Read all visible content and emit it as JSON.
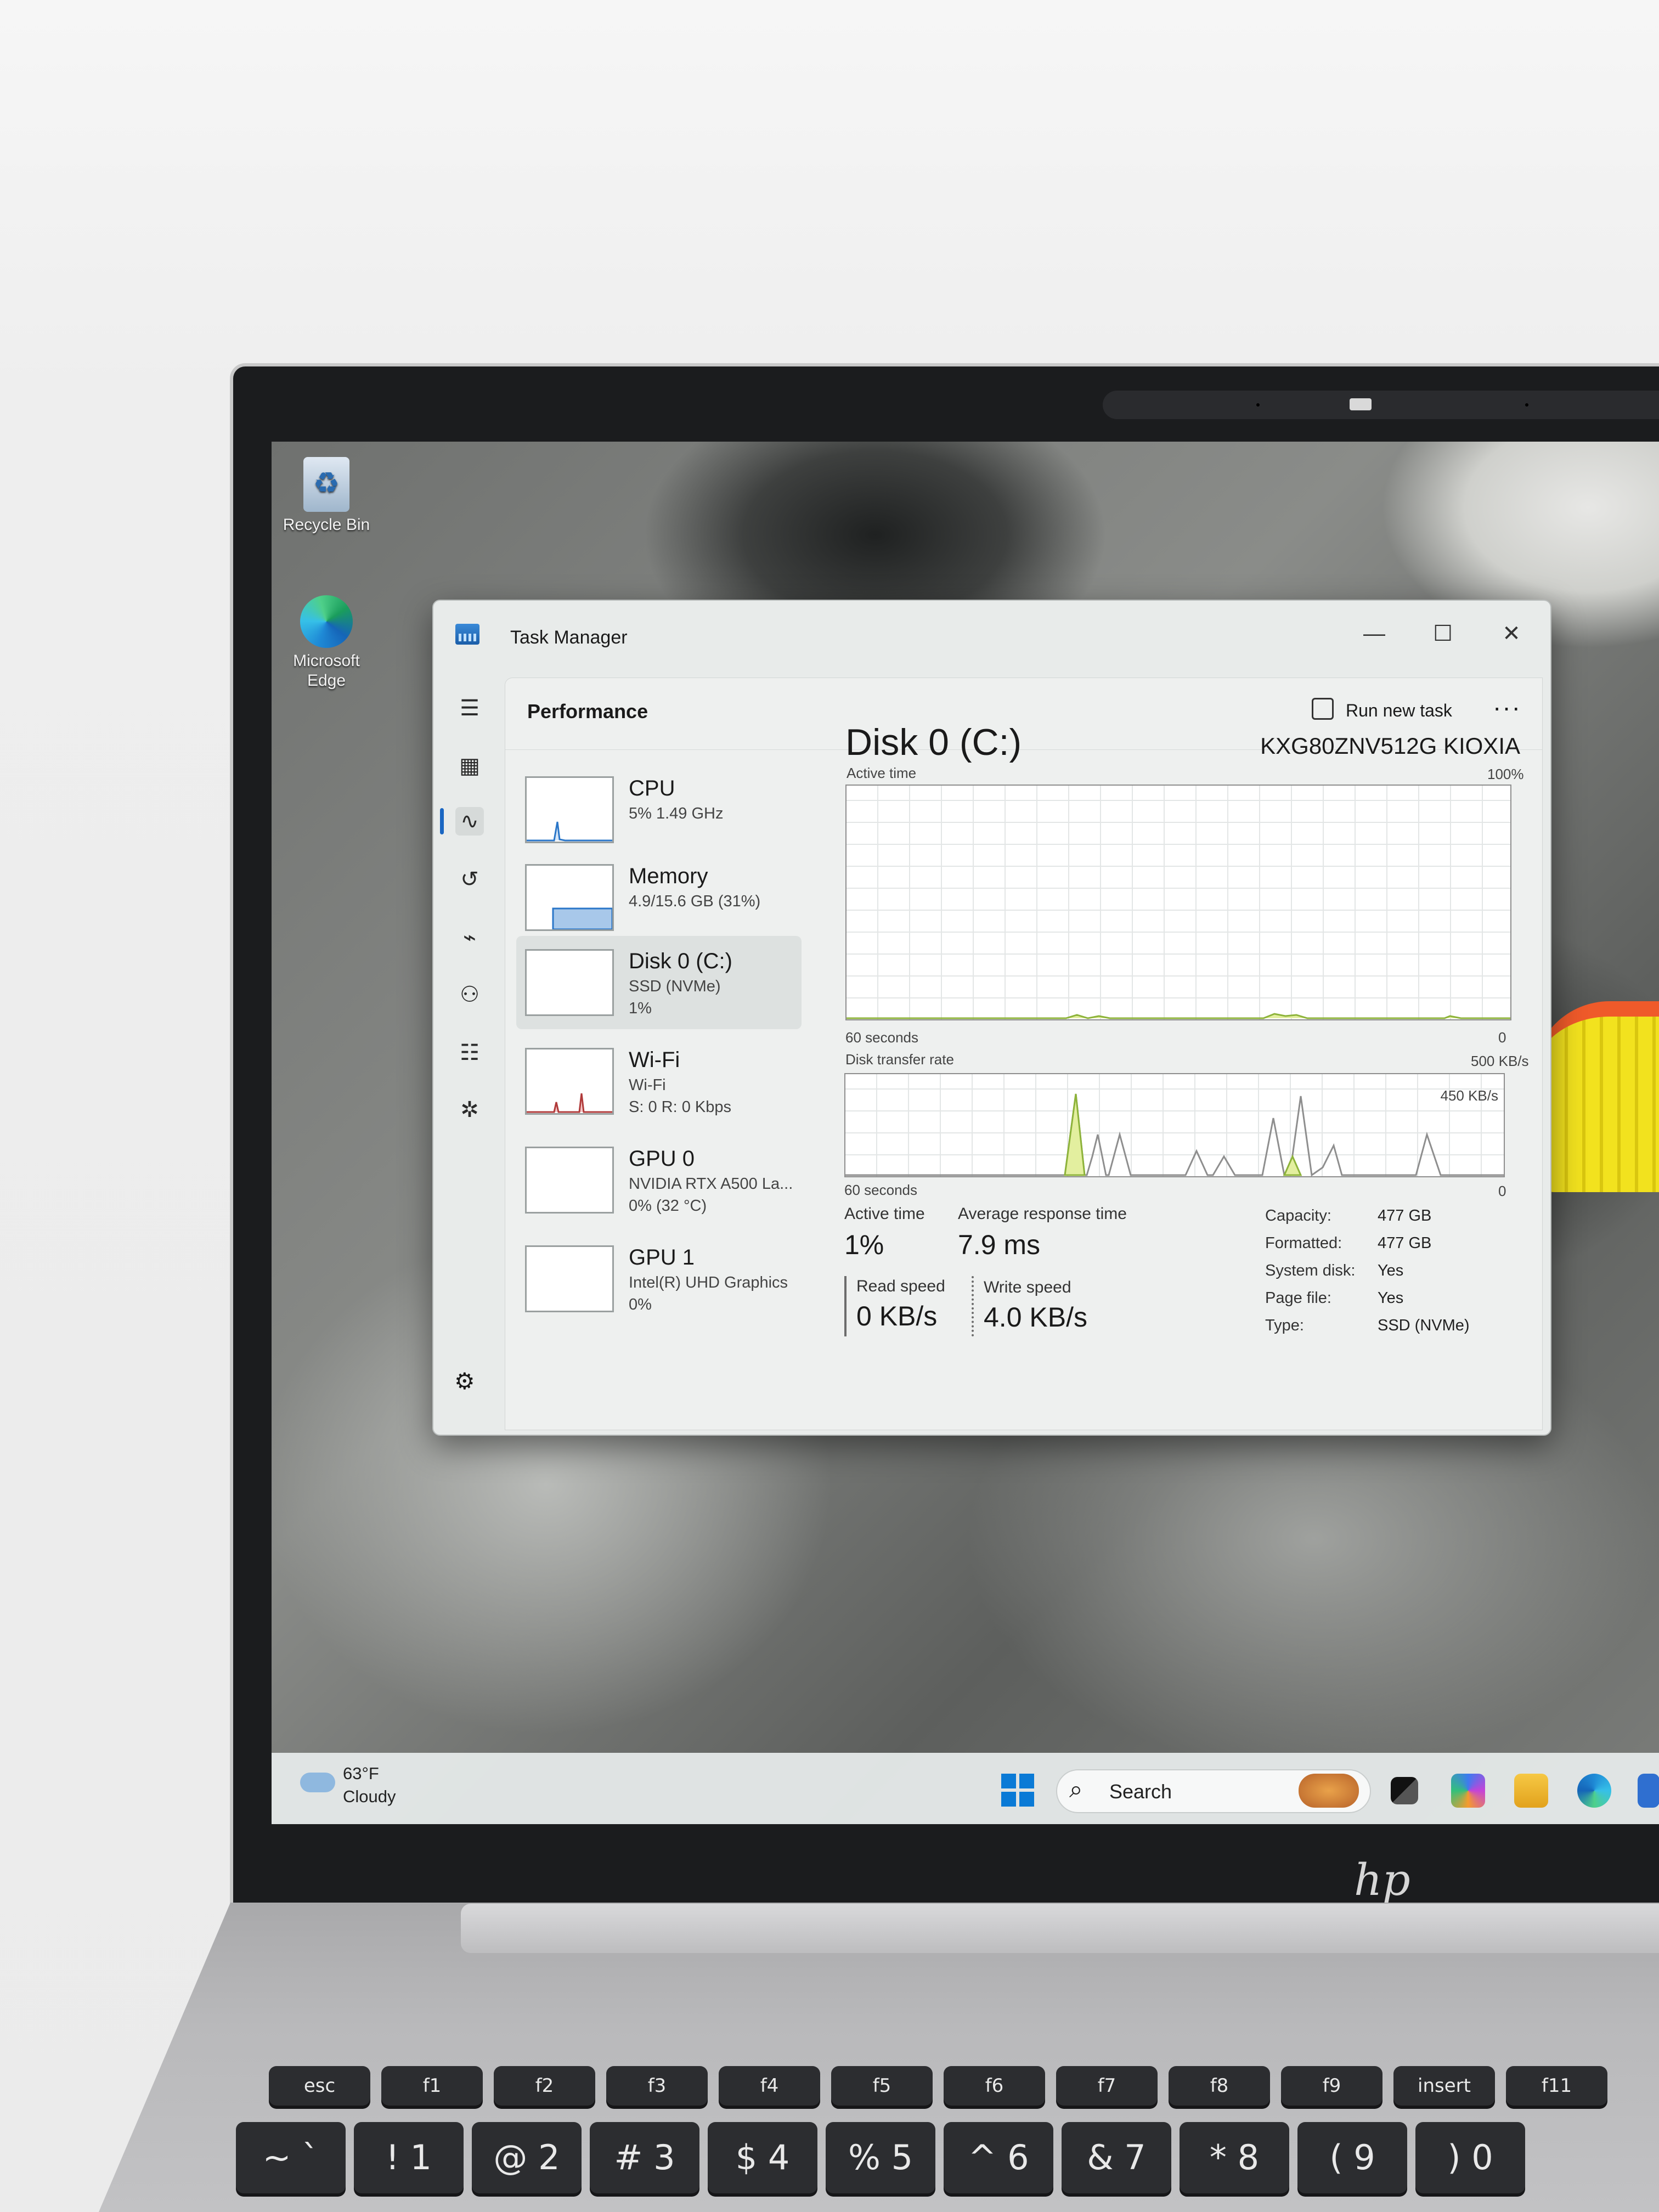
{
  "desktop": {
    "icons": [
      {
        "label": "Recycle Bin",
        "icon": "recycle-bin-icon"
      },
      {
        "label": "Microsoft Edge",
        "icon": "edge-icon"
      }
    ]
  },
  "window": {
    "title": "Task Manager",
    "controls": {
      "minimize": "—",
      "maximize": "☐",
      "close": "✕"
    }
  },
  "nav": {
    "items": [
      "menu-icon",
      "processes-icon",
      "performance-icon",
      "app-history-icon",
      "startup-apps-icon",
      "users-icon",
      "details-icon",
      "services-icon",
      "settings-icon"
    ],
    "active": "performance"
  },
  "header": {
    "title": "Performance",
    "run_new_task": "Run new task",
    "more": "···"
  },
  "devices": [
    {
      "name": "CPU",
      "sub1": "5%  1.49 GHz",
      "sub2": ""
    },
    {
      "name": "Memory",
      "sub1": "4.9/15.6 GB (31%)",
      "sub2": ""
    },
    {
      "name": "Disk 0 (C:)",
      "sub1": "SSD (NVMe)",
      "sub2": "1%"
    },
    {
      "name": "Wi-Fi",
      "sub1": "Wi-Fi",
      "sub2": "S: 0  R: 0 Kbps"
    },
    {
      "name": "GPU 0",
      "sub1": "NVIDIA RTX A500 La...",
      "sub2": "0%  (32 °C)"
    },
    {
      "name": "GPU 1",
      "sub1": "Intel(R) UHD Graphics",
      "sub2": "0%"
    }
  ],
  "detail": {
    "title": "Disk 0 (C:)",
    "model": "KXG80ZNV512G KIOXIA",
    "active_graph": {
      "label": "Active time",
      "max": "100%",
      "span": "60 seconds",
      "min": "0"
    },
    "transfer_graph": {
      "label": "Disk transfer rate",
      "max": "500 KB/s",
      "inner_max": "450 KB/s",
      "span": "60 seconds",
      "min": "0"
    },
    "stats": {
      "active_time_label": "Active time",
      "active_time_value": "1%",
      "response_label": "Average response time",
      "response_value": "7.9 ms",
      "read_label": "Read speed",
      "read_value": "0 KB/s",
      "write_label": "Write speed",
      "write_value": "4.0 KB/s"
    },
    "properties": [
      {
        "label": "Capacity:",
        "value": "477 GB"
      },
      {
        "label": "Formatted:",
        "value": "477 GB"
      },
      {
        "label": "System disk:",
        "value": "Yes"
      },
      {
        "label": "Page file:",
        "value": "Yes"
      },
      {
        "label": "Type:",
        "value": "SSD (NVMe)"
      }
    ]
  },
  "taskbar": {
    "weather_temp": "63°F",
    "weather_cond": "Cloudy",
    "search_placeholder": "Search",
    "apps": [
      "start-icon",
      "task-view-icon",
      "copilot-icon",
      "file-explorer-icon",
      "edge-icon",
      "store-icon"
    ]
  },
  "laptop": {
    "brand": "hp",
    "fn_keys": [
      "esc",
      "f1",
      "f2",
      "f3",
      "f4",
      "f5",
      "f6",
      "f7",
      "f8",
      "f9",
      "insert",
      "f11"
    ],
    "num_keys": [
      "~ `",
      "! 1",
      "@ 2",
      "# 3",
      "$ 4",
      "% 5",
      "^ 6",
      "& 7",
      "* 8",
      "( 9",
      ") 0"
    ]
  },
  "colors": {
    "accent": "#1a66c2",
    "graph_line": "#8db33a",
    "graph_fill": "#e3ef9f"
  }
}
